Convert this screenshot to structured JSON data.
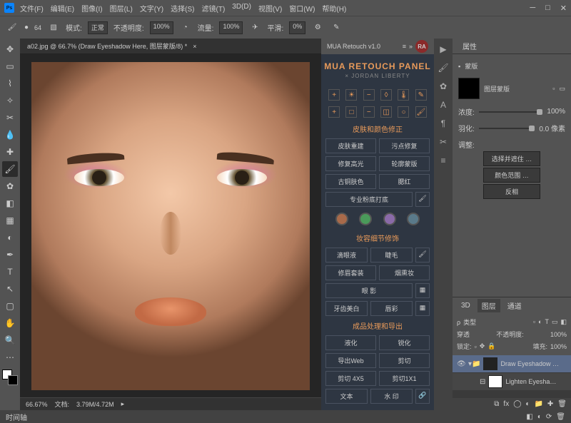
{
  "menu": [
    "文件(F)",
    "编辑(E)",
    "图像(I)",
    "图层(L)",
    "文字(Y)",
    "选择(S)",
    "滤镜(T)",
    "3D(D)",
    "视图(V)",
    "窗口(W)",
    "帮助(H)"
  ],
  "optbar": {
    "size": "64",
    "mode_label": "模式:",
    "mode_val": "正常",
    "opacity_label": "不透明度:",
    "opacity_val": "100%",
    "flow_label": "流量:",
    "flow_val": "100%",
    "smooth_label": "平滑:",
    "smooth_val": "0%"
  },
  "doc": {
    "tab": "a02.jpg @ 66.7% (Draw Eyeshadow Here, 图层蒙版/8) *"
  },
  "status": {
    "zoom": "66.67%",
    "docinfo_label": "文档:",
    "docinfo": "3.79M/4.72M"
  },
  "plugin": {
    "title": "MUA Retouch v1.0",
    "badge": "RA",
    "logo1": "MUA RETOUCH PANEL",
    "logo2": "× JORDAN LIBERTY",
    "sec1": "皮肤和颜色修正",
    "btns1": [
      [
        "皮肤重建",
        "污点修复"
      ],
      [
        "修复高光",
        "轮廓蒙版"
      ],
      [
        "古铜肤色",
        "腮红"
      ]
    ],
    "btns1_wide": "专业粉底打底",
    "colors": [
      "#a86a4a",
      "#4a9a5a",
      "#8a6aa8",
      "#5a7a8a"
    ],
    "sec2": "妆容细节修饰",
    "btns2": [
      [
        "滴眼液",
        "睫毛"
      ],
      [
        "修眉套装",
        "烟熏妆"
      ]
    ],
    "btns2_wide": "眼 影",
    "btns2b": [
      [
        "牙齿美白",
        "唇彩"
      ]
    ],
    "sec3": "成品处理和导出",
    "btns3": [
      [
        "液化",
        "锐化"
      ],
      [
        "导出Web",
        "剪切"
      ],
      [
        "剪切 4X5",
        "剪切1X1"
      ],
      [
        "文本",
        "水 印"
      ]
    ]
  },
  "props": {
    "tab": "属性",
    "mask_label": "蒙版",
    "layermask": "图层蒙版",
    "density_label": "浓度:",
    "density": "100%",
    "feather_label": "羽化:",
    "feather": "0.0 像素",
    "adjust": "调整:",
    "btn1": "选择并遮住 …",
    "btn2": "颜色范围 …",
    "btn3": "反相"
  },
  "layers": {
    "tab_3d": "3D",
    "tab_layer": "图层",
    "tab_channel": "通道",
    "kind": "类型",
    "blend": "穿透",
    "opacity_label": "不透明度:",
    "opacity": "100%",
    "lock": "锁定:",
    "fill_label": "填充:",
    "fill": "100%",
    "items": [
      {
        "name": "Draw Eyeshadow …",
        "sel": true,
        "open": true
      },
      {
        "name": "Lighten Eyesha…",
        "sel": false,
        "open": false
      }
    ]
  },
  "bottom": {
    "label": "时间轴"
  }
}
